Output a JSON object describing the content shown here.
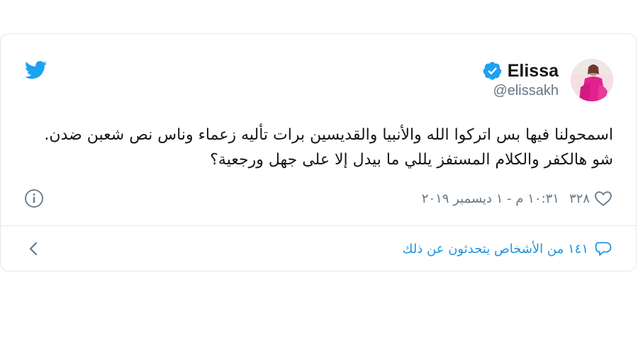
{
  "user": {
    "display_name": "Elissa",
    "handle": "@elissakh",
    "verified": true
  },
  "tweet": {
    "line1": "اسمحولنا فيها بس اتركوا الله والأنبيا والقديسين برات تأليه زعماء وناس نص شعبن ضدن.",
    "line2": "شو هالكفر والكلام المستفز يللي ما بيدل إلا على جهل ورجعية؟"
  },
  "meta": {
    "timestamp": "١٠:٣١ م - ١ ديسمبر ٢٠١٩",
    "like_count": "٣٢٨"
  },
  "conversation": {
    "label": "١٤١ من الأشخاص يتحدثون عن ذلك"
  },
  "colors": {
    "twitter_blue": "#1da1f2",
    "link_blue": "#1b95e0",
    "text_primary": "#14171a",
    "text_secondary": "#657786",
    "border": "#e1e8ed",
    "avatar_pink": "#e2218f"
  },
  "icons": {
    "logo": "twitter-bird-icon",
    "verified": "verified-badge-icon",
    "like": "heart-icon",
    "info": "info-icon",
    "reply": "speech-bubble-icon",
    "back": "chevron-left-icon"
  }
}
